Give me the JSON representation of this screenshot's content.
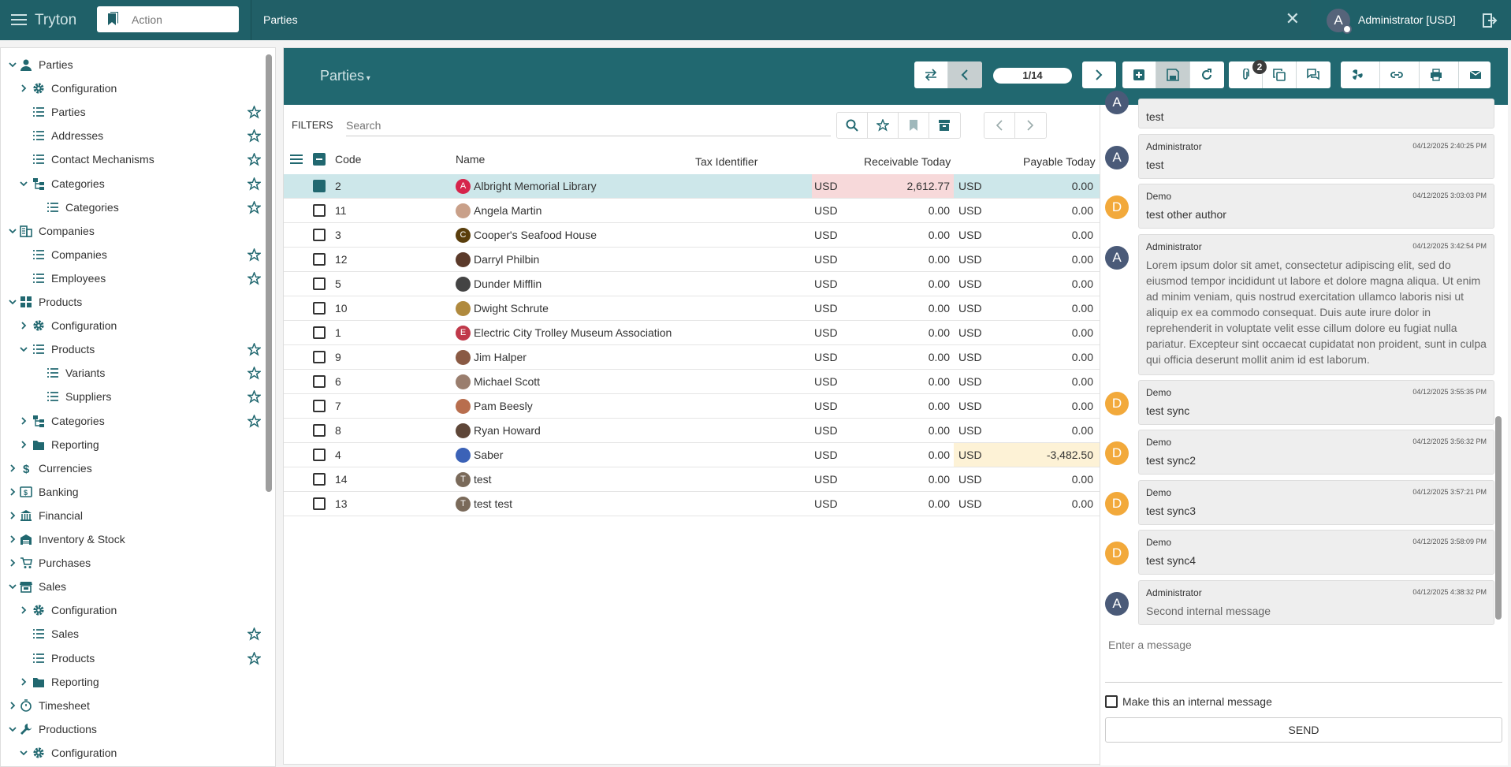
{
  "app": {
    "brand": "Tryton",
    "action_placeholder": "Action",
    "tab_title": "Parties",
    "user_initial": "A",
    "user_name": "Administrator [USD]"
  },
  "sidebar": {
    "items": [
      {
        "label": "Parties",
        "depth": 0,
        "expanded": true,
        "icon": "person-icon",
        "star": false
      },
      {
        "label": "Configuration",
        "depth": 1,
        "expanded": false,
        "icon": "gear-icon",
        "star": false
      },
      {
        "label": "Parties",
        "depth": 1,
        "expanded": null,
        "icon": "list-icon",
        "star": true
      },
      {
        "label": "Addresses",
        "depth": 1,
        "expanded": null,
        "icon": "list-icon",
        "star": true
      },
      {
        "label": "Contact Mechanisms",
        "depth": 1,
        "expanded": null,
        "icon": "list-icon",
        "star": true
      },
      {
        "label": "Categories",
        "depth": 1,
        "expanded": true,
        "icon": "tree-icon",
        "star": true
      },
      {
        "label": "Categories",
        "depth": 2,
        "expanded": null,
        "icon": "list-icon",
        "star": true
      },
      {
        "label": "Companies",
        "depth": 0,
        "expanded": true,
        "icon": "building-icon",
        "star": false
      },
      {
        "label": "Companies",
        "depth": 1,
        "expanded": null,
        "icon": "list-icon",
        "star": true
      },
      {
        "label": "Employees",
        "depth": 1,
        "expanded": null,
        "icon": "list-icon",
        "star": true
      },
      {
        "label": "Products",
        "depth": 0,
        "expanded": true,
        "icon": "grid-icon",
        "star": false
      },
      {
        "label": "Configuration",
        "depth": 1,
        "expanded": false,
        "icon": "gear-icon",
        "star": false
      },
      {
        "label": "Products",
        "depth": 1,
        "expanded": true,
        "icon": "list-icon",
        "star": true
      },
      {
        "label": "Variants",
        "depth": 2,
        "expanded": null,
        "icon": "list-icon",
        "star": true
      },
      {
        "label": "Suppliers",
        "depth": 2,
        "expanded": null,
        "icon": "list-icon",
        "star": true
      },
      {
        "label": "Categories",
        "depth": 1,
        "expanded": false,
        "icon": "tree-icon",
        "star": true
      },
      {
        "label": "Reporting",
        "depth": 1,
        "expanded": false,
        "icon": "folder-icon",
        "star": false
      },
      {
        "label": "Currencies",
        "depth": 0,
        "expanded": false,
        "icon": "dollar-icon",
        "star": false
      },
      {
        "label": "Banking",
        "depth": 0,
        "expanded": false,
        "icon": "bank-card-icon",
        "star": false
      },
      {
        "label": "Financial",
        "depth": 0,
        "expanded": false,
        "icon": "bank-icon",
        "star": false
      },
      {
        "label": "Inventory & Stock",
        "depth": 0,
        "expanded": false,
        "icon": "warehouse-icon",
        "star": false
      },
      {
        "label": "Purchases",
        "depth": 0,
        "expanded": false,
        "icon": "cart-icon",
        "star": false
      },
      {
        "label": "Sales",
        "depth": 0,
        "expanded": true,
        "icon": "store-icon",
        "star": false
      },
      {
        "label": "Configuration",
        "depth": 1,
        "expanded": false,
        "icon": "gear-icon",
        "star": false
      },
      {
        "label": "Sales",
        "depth": 1,
        "expanded": null,
        "icon": "list-icon",
        "star": true
      },
      {
        "label": "Products",
        "depth": 1,
        "expanded": null,
        "icon": "list-icon",
        "star": true
      },
      {
        "label": "Reporting",
        "depth": 1,
        "expanded": false,
        "icon": "folder-icon",
        "star": false
      },
      {
        "label": "Timesheet",
        "depth": 0,
        "expanded": false,
        "icon": "timer-icon",
        "star": false
      },
      {
        "label": "Productions",
        "depth": 0,
        "expanded": true,
        "icon": "wrench-icon",
        "star": false
      },
      {
        "label": "Configuration",
        "depth": 1,
        "expanded": true,
        "icon": "gear-icon",
        "star": false
      }
    ]
  },
  "form": {
    "title": "Parties",
    "counter": "1/14",
    "attachment_count": "2"
  },
  "filters": {
    "label": "FILTERS",
    "search_placeholder": "Search"
  },
  "table": {
    "columns": [
      "Code",
      "Name",
      "Tax Identifier",
      "Receivable Today",
      "Payable Today"
    ],
    "rows": [
      {
        "code": "2",
        "name": "Albright Memorial Library",
        "avatar": "A",
        "avatar_color": "#d6244b",
        "cur1": "USD",
        "receivable": "2,612.77",
        "cur2": "USD",
        "payable": "0.00",
        "selected": true
      },
      {
        "code": "11",
        "name": "Angela Martin",
        "avatar": "",
        "avatar_color": "#c9a089",
        "cur1": "USD",
        "receivable": "0.00",
        "cur2": "USD",
        "payable": "0.00",
        "selected": false
      },
      {
        "code": "3",
        "name": "Cooper's Seafood House",
        "avatar": "C",
        "avatar_color": "#5a3e0c",
        "cur1": "USD",
        "receivable": "0.00",
        "cur2": "USD",
        "payable": "0.00",
        "selected": false
      },
      {
        "code": "12",
        "name": "Darryl Philbin",
        "avatar": "",
        "avatar_color": "#5b3a2a",
        "cur1": "USD",
        "receivable": "0.00",
        "cur2": "USD",
        "payable": "0.00",
        "selected": false
      },
      {
        "code": "5",
        "name": "Dunder Mifflin",
        "avatar": "",
        "avatar_color": "#444444",
        "cur1": "USD",
        "receivable": "0.00",
        "cur2": "USD",
        "payable": "0.00",
        "selected": false
      },
      {
        "code": "10",
        "name": "Dwight Schrute",
        "avatar": "",
        "avatar_color": "#b08a3e",
        "cur1": "USD",
        "receivable": "0.00",
        "cur2": "USD",
        "payable": "0.00",
        "selected": false
      },
      {
        "code": "1",
        "name": "Electric City Trolley Museum Association",
        "avatar": "E",
        "avatar_color": "#c0394a",
        "cur1": "USD",
        "receivable": "0.00",
        "cur2": "USD",
        "payable": "0.00",
        "selected": false
      },
      {
        "code": "9",
        "name": "Jim Halper",
        "avatar": "",
        "avatar_color": "#8a5a44",
        "cur1": "USD",
        "receivable": "0.00",
        "cur2": "USD",
        "payable": "0.00",
        "selected": false
      },
      {
        "code": "6",
        "name": "Michael Scott",
        "avatar": "",
        "avatar_color": "#9a7e6e",
        "cur1": "USD",
        "receivable": "0.00",
        "cur2": "USD",
        "payable": "0.00",
        "selected": false
      },
      {
        "code": "7",
        "name": "Pam Beesly",
        "avatar": "",
        "avatar_color": "#b86e4e",
        "cur1": "USD",
        "receivable": "0.00",
        "cur2": "USD",
        "payable": "0.00",
        "selected": false
      },
      {
        "code": "8",
        "name": "Ryan Howard",
        "avatar": "",
        "avatar_color": "#5e4638",
        "cur1": "USD",
        "receivable": "0.00",
        "cur2": "USD",
        "payable": "0.00",
        "selected": false
      },
      {
        "code": "4",
        "name": "Saber",
        "avatar": "",
        "avatar_color": "#3b62b7",
        "cur1": "USD",
        "receivable": "0.00",
        "cur2": "USD",
        "payable": "-3,482.50",
        "selected": false
      },
      {
        "code": "14",
        "name": "test",
        "avatar": "T",
        "avatar_color": "#7a6a5a",
        "cur1": "USD",
        "receivable": "0.00",
        "cur2": "USD",
        "payable": "0.00",
        "selected": false
      },
      {
        "code": "13",
        "name": "test test",
        "avatar": "T",
        "avatar_color": "#7a6a5a",
        "cur1": "USD",
        "receivable": "0.00",
        "cur2": "USD",
        "payable": "0.00",
        "selected": false
      }
    ]
  },
  "chat": {
    "messages": [
      {
        "author": "",
        "date": "",
        "text": "test",
        "initial": "A",
        "color": "#4a5a78"
      },
      {
        "author": "Administrator",
        "date": "04/12/2025 2:40:25 PM",
        "text": "test",
        "initial": "A",
        "color": "#4a5a78"
      },
      {
        "author": "Demo",
        "date": "04/12/2025 3:03:03 PM",
        "text": "test other author",
        "initial": "D",
        "color": "#f2a93b"
      },
      {
        "author": "Administrator",
        "date": "04/12/2025 3:42:54 PM",
        "text": "Lorem ipsum dolor sit amet, consectetur adipiscing elit, sed do eiusmod tempor incididunt ut labore et dolore magna aliqua. Ut enim ad minim veniam, quis nostrud exercitation ullamco laboris nisi ut aliquip ex ea commodo consequat. Duis aute irure dolor in reprehenderit in voluptate velit esse cillum dolore eu fugiat nulla pariatur. Excepteur sint occaecat cupidatat non proident, sunt in culpa qui officia deserunt mollit anim id est laborum.",
        "initial": "A",
        "color": "#4a5a78"
      },
      {
        "author": "Demo",
        "date": "04/12/2025 3:55:35 PM",
        "text": "test sync",
        "initial": "D",
        "color": "#f2a93b"
      },
      {
        "author": "Demo",
        "date": "04/12/2025 3:56:32 PM",
        "text": "test sync2",
        "initial": "D",
        "color": "#f2a93b"
      },
      {
        "author": "Demo",
        "date": "04/12/2025 3:57:21 PM",
        "text": "test sync3",
        "initial": "D",
        "color": "#f2a93b"
      },
      {
        "author": "Demo",
        "date": "04/12/2025 3:58:09 PM",
        "text": "test sync4",
        "initial": "D",
        "color": "#f2a93b"
      },
      {
        "author": "Administrator",
        "date": "04/12/2025 4:38:32 PM",
        "text": "Second internal message",
        "initial": "A",
        "color": "#4a5a78"
      }
    ],
    "input_placeholder": "Enter a message",
    "internal_label": "Make this an internal message",
    "send_label": "SEND"
  },
  "colors": {
    "header_bg": "#1f6068",
    "panel_header_bg": "#216870",
    "selected_row": "#cde7ea",
    "receivable_highlight": "#f7d9da",
    "payable_highlight": "#fdf2d6"
  }
}
